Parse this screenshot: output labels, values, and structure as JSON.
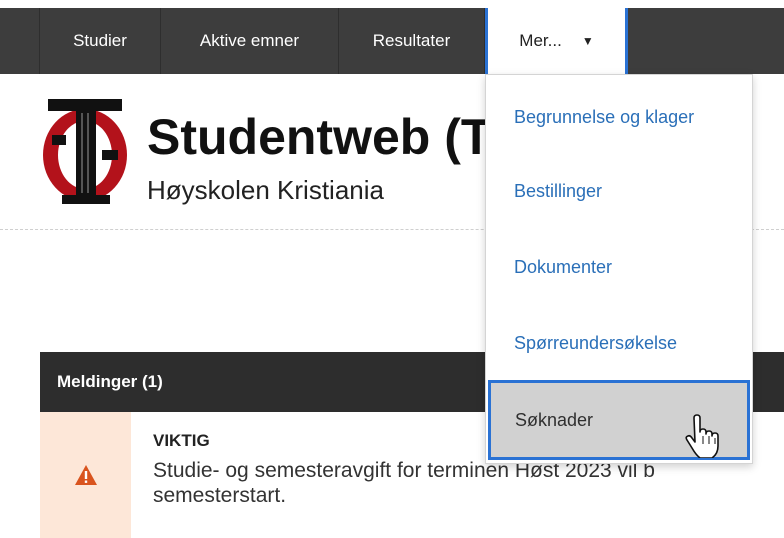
{
  "nav": {
    "items": [
      {
        "label": "Studier"
      },
      {
        "label": "Aktive emner"
      },
      {
        "label": "Resultater"
      },
      {
        "label": "Mer..."
      }
    ]
  },
  "header": {
    "title": "Studentweb (T",
    "subtitle": "Høyskolen Kristiania"
  },
  "dropdown": {
    "items": [
      {
        "label": "Begrunnelse og klager"
      },
      {
        "label": "Bestillinger"
      },
      {
        "label": "Dokumenter"
      },
      {
        "label": "Spørreundersøkelse"
      },
      {
        "label": "Søknader"
      }
    ],
    "hovered_index": 4
  },
  "messages": {
    "header": "Meldinger (1)",
    "items": [
      {
        "title": "VIKTIG",
        "text": "Studie- og semesteravgift for terminen Høst 2023 vil b semesterstart."
      }
    ]
  },
  "colors": {
    "nav_bg": "#3d3d3d",
    "link": "#2a6fb8",
    "focus_border": "#2a72d4",
    "warning": "#d9541e",
    "logo_red": "#b3121b"
  }
}
